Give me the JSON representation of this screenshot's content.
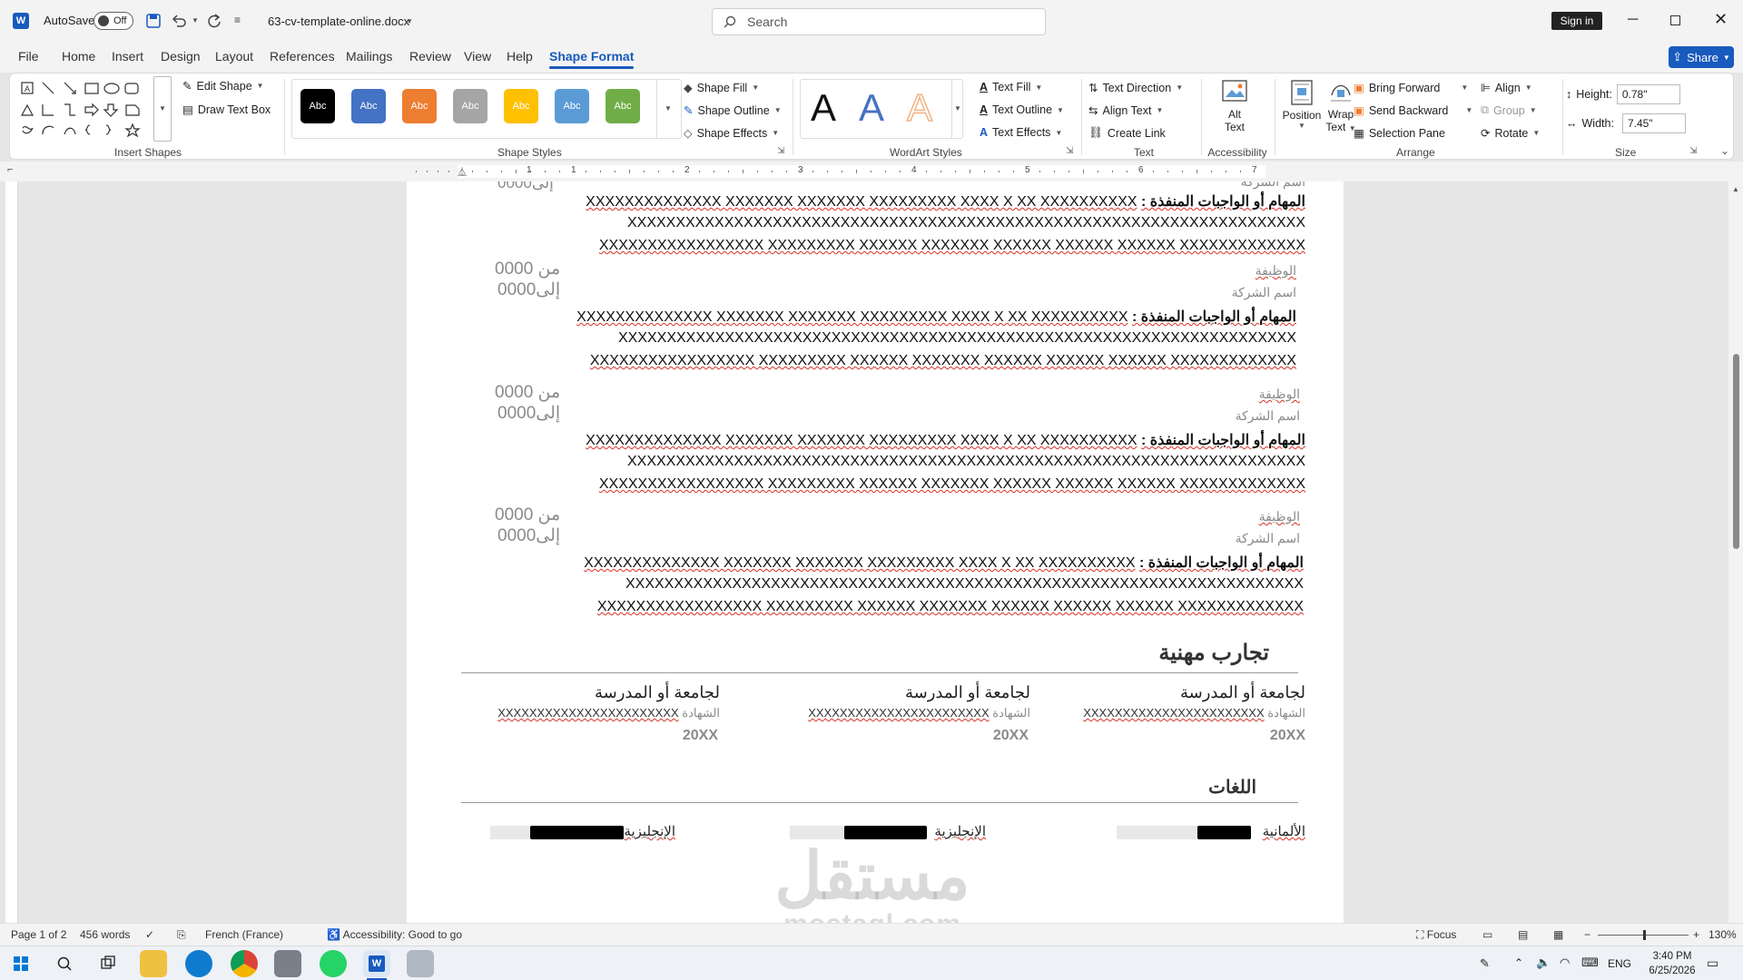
{
  "titlebar": {
    "autosave_label": "AutoSave",
    "autosave_state": "Off",
    "filename": "63-cv-template-online.docx",
    "search_placeholder": "Search",
    "signin_label": "Sign in"
  },
  "menu_tabs": [
    "File",
    "Home",
    "Insert",
    "Design",
    "Layout",
    "References",
    "Mailings",
    "Review",
    "View",
    "Help",
    "Shape Format"
  ],
  "active_tab": "Shape Format",
  "share_label": "Share",
  "ribbon": {
    "insert_shapes": {
      "label": "Insert Shapes",
      "edit_shape": "Edit Shape",
      "draw_text_box": "Draw Text Box"
    },
    "shape_styles": {
      "label": "Shape Styles",
      "swatch_text": "Abc",
      "swatch_colors": [
        "#000000",
        "#4472c4",
        "#ed7d31",
        "#a5a5a5",
        "#ffc000",
        "#5b9bd5",
        "#70ad47"
      ],
      "shape_fill": "Shape Fill",
      "shape_outline": "Shape Outline",
      "shape_effects": "Shape Effects"
    },
    "wordart": {
      "label": "WordArt Styles",
      "letter": "A",
      "text_fill": "Text Fill",
      "text_outline": "Text Outline",
      "text_effects": "Text Effects"
    },
    "text": {
      "label": "Text",
      "text_direction": "Text Direction",
      "align_text": "Align Text",
      "create_link": "Create Link"
    },
    "accessibility": {
      "label": "Accessibility",
      "alt_text_1": "Alt",
      "alt_text_2": "Text"
    },
    "arrange": {
      "label": "Arrange",
      "position": "Position",
      "wrap_1": "Wrap",
      "wrap_2": "Text",
      "bring_forward": "Bring Forward",
      "send_backward": "Send Backward",
      "selection_pane": "Selection Pane",
      "align": "Align",
      "group": "Group",
      "rotate": "Rotate"
    },
    "size": {
      "label": "Size",
      "height_label": "Height:",
      "height_value": "0.78\"",
      "width_label": "Width:",
      "width_value": "7.45\""
    }
  },
  "ruler_numbers": [
    "1",
    "1",
    "2",
    "3",
    "4",
    "5",
    "6",
    "7"
  ],
  "document": {
    "job_title": "الوظيفة",
    "company": "اسم الشركة",
    "from": "من 0000",
    "to": "إلى0000",
    "tasks_label": "المهام أو الواجبات المنفذة :",
    "tasks_line1": "XXXXXXXXXXXXXX XXXXXXX XXXXXXX XXXXXXXXX XXXX X XX XXXXXXXXXX",
    "tasks_line2": "XXXXXXXXXXXXXXXXXXXXXXXXXXXXXXXXXXXXXXXXXXXXXXXXXXXXXXXXXXXXXXXXXXXXXX",
    "tasks_line3": "XXXXXXXXXXXXXXXXX XXXXXXXXX XXXXXX XXXXXXX XXXXXX XXXXXX XXXXXX XXXXXXXXXXXXX",
    "exp_heading": "تجارب مهنية",
    "edu_school": "لجامعة أو المدرسة",
    "edu_degree_label": "الشهادة",
    "edu_degree_value": "XXXXXXXXXXXXXXXXXXXXXXX",
    "edu_year": "20XX",
    "lang_heading": "اللغات",
    "languages": [
      {
        "name": "الألمانية",
        "level": 0.4
      },
      {
        "name": "الإنجليزية",
        "level": 0.6
      },
      {
        "name": "الإنجليزية",
        "level": 0.7
      }
    ]
  },
  "watermark": {
    "arabic": "مستقل",
    "latin": "mostaql.com"
  },
  "status": {
    "page": "Page 1 of 2",
    "words": "456 words",
    "language": "French (France)",
    "accessibility": "Accessibility: Good to go",
    "focus": "Focus",
    "zoom": "130%"
  },
  "taskbar": {
    "lang": "ENG",
    "time": "3:40 PM",
    "date": "6/25/2026"
  }
}
